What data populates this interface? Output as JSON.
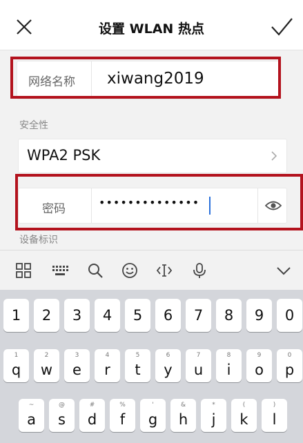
{
  "header": {
    "title": "设置 WLAN 热点"
  },
  "form": {
    "ssid_label": "网络名称",
    "ssid_value": "xiwang2019",
    "security_section_label": "安全性",
    "security_value": "WPA2 PSK",
    "password_label": "密码",
    "password_value": "••••••••••••••",
    "device_id_label": "设备标识"
  },
  "icons": {
    "close": "close-icon",
    "confirm": "check-icon",
    "chevron": "chevron-right-icon",
    "eye": "eye-icon",
    "toolbar": [
      "grid-icon",
      "keyboard-icon",
      "search-icon",
      "emoji-icon",
      "cursor-icon",
      "microphone-icon",
      "chevron-down-icon"
    ]
  },
  "keyboard": {
    "row1": [
      {
        "k": "1"
      },
      {
        "k": "2"
      },
      {
        "k": "3"
      },
      {
        "k": "4"
      },
      {
        "k": "5"
      },
      {
        "k": "6"
      },
      {
        "k": "7"
      },
      {
        "k": "8"
      },
      {
        "k": "9"
      },
      {
        "k": "0"
      }
    ],
    "row2": [
      {
        "h": "1",
        "k": "q"
      },
      {
        "h": "2",
        "k": "w"
      },
      {
        "h": "3",
        "k": "e"
      },
      {
        "h": "4",
        "k": "r"
      },
      {
        "h": "5",
        "k": "t"
      },
      {
        "h": "6",
        "k": "y"
      },
      {
        "h": "7",
        "k": "u"
      },
      {
        "h": "8",
        "k": "i"
      },
      {
        "h": "9",
        "k": "o"
      },
      {
        "h": "0",
        "k": "p"
      }
    ],
    "row3": [
      {
        "h": "~",
        "k": "a"
      },
      {
        "h": "@",
        "k": "s"
      },
      {
        "h": "#",
        "k": "d"
      },
      {
        "h": "%",
        "k": "f"
      },
      {
        "h": "'",
        "k": "g"
      },
      {
        "h": "&",
        "k": "h"
      },
      {
        "h": "*",
        "k": "j"
      },
      {
        "h": "(",
        "k": "k"
      },
      {
        "h": ")",
        "k": "l"
      }
    ]
  },
  "colors": {
    "highlight": "#b3121d",
    "keyboard_bg": "#d4d6db"
  }
}
